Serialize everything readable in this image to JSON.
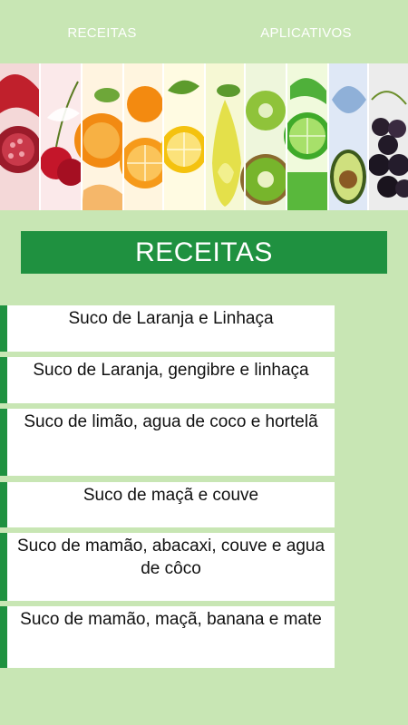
{
  "tabs": [
    {
      "label": "RECEITAS"
    },
    {
      "label": "APLICATIVOS"
    }
  ],
  "banner": {
    "fruits": [
      "pomegranate",
      "cherry",
      "orange",
      "lemon",
      "pear",
      "kiwi",
      "lime",
      "avocado",
      "grape"
    ]
  },
  "page_title": "RECEITAS",
  "recipes": [
    {
      "label": "Suco de Laranja e Linhaça"
    },
    {
      "label": "Suco de Laranja, gengibre e linhaça"
    },
    {
      "label": "Suco de limão, agua de coco e hortelã"
    },
    {
      "label": "Suco de maçã e couve"
    },
    {
      "label": "Suco de mamão, abacaxi, couve e agua de côco"
    },
    {
      "label": "Suco de mamão, maçã, banana e mate"
    }
  ],
  "colors": {
    "background": "#c8e6b4",
    "accent": "#1f9140",
    "card": "#ffffff"
  }
}
